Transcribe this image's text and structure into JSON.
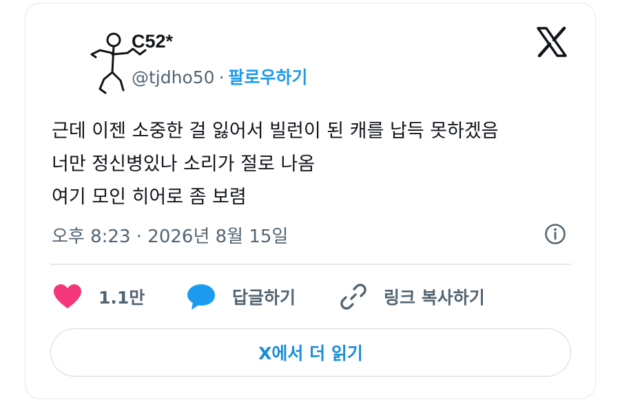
{
  "author": {
    "display_name": "C52*",
    "handle": "@tjdho50",
    "separator": "·",
    "follow_label": "팔로우하기"
  },
  "brand": {
    "logo_icon": "x-logo-icon"
  },
  "tweet": {
    "lines": [
      "근데 이젠 소중한 걸 잃어서 빌런이 된 캐를 납득 못하겠음",
      "너만 정신병있나 소리가 절로 나옴",
      "여기 모인 히어로 좀 보렴"
    ],
    "timestamp": "오후 8:23 · 2026년 8월 15일"
  },
  "actions": {
    "like_count": "1.1만",
    "reply_label": "답글하기",
    "copy_link_label": "링크 복사하기"
  },
  "read_more_label": "X에서 더 읽기",
  "colors": {
    "like": "#f4377b",
    "reply": "#1d9bf0",
    "link": "#1a8cd8",
    "muted": "#536471",
    "border": "#e3e6e8"
  },
  "icons": [
    "heart-icon",
    "reply-bubble-icon",
    "link-icon",
    "info-icon"
  ]
}
